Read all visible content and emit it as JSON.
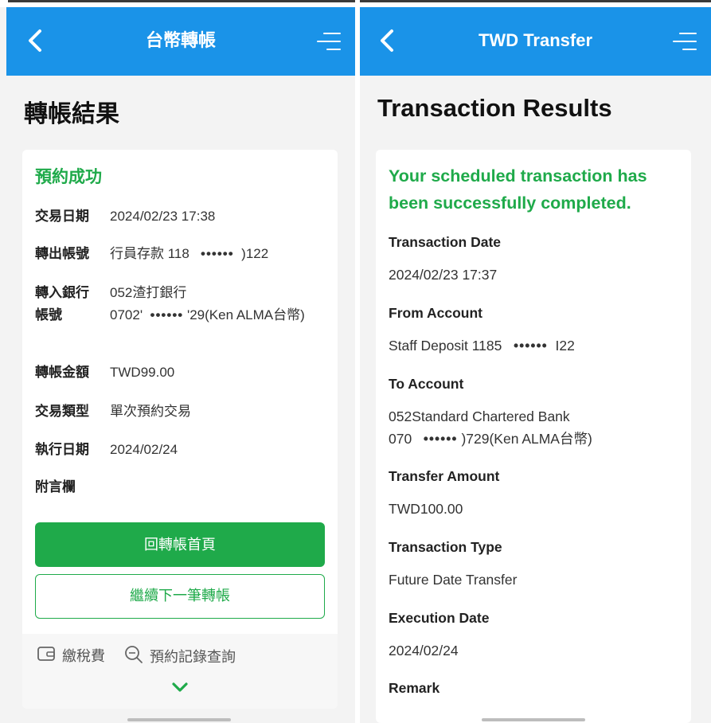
{
  "left": {
    "header_title": "台幣轉帳",
    "page_title": "轉帳結果",
    "status": "預約成功",
    "rows": {
      "date_label": "交易日期",
      "date_value": "2024/02/23 17:38",
      "from_label": "轉出帳號",
      "from_value_prefix": "行員存款 118",
      "from_mask": "••••••",
      "from_value_suffix": ")122",
      "to_label_1": "轉入銀行",
      "to_label_2": "帳號",
      "to_bank": "052渣打銀行",
      "to_account_prefix": "0702'",
      "to_mask": "••••••",
      "to_account_suffix": "'29(Ken ALMA台幣)",
      "amount_label": "轉帳金額",
      "amount_value": "TWD99.00",
      "type_label": "交易類型",
      "type_value": "單次預約交易",
      "exec_label": "執行日期",
      "exec_value": "2024/02/24",
      "remark_label": "附言欄"
    },
    "btn_home": "回轉帳首頁",
    "btn_next": "繼續下一筆轉帳",
    "quick_tax": "繳稅費",
    "quick_query": "預約記錄查詢"
  },
  "right": {
    "header_title": "TWD Transfer",
    "page_title": "Transaction Results",
    "status": "Your scheduled transaction has been successfully completed.",
    "date_label": "Transaction Date",
    "date_value": "2024/02/23 17:37",
    "from_label": "From Account",
    "from_value_prefix": "Staff Deposit 1185",
    "from_mask": "••••••",
    "from_value_suffix": "I22",
    "to_label": "To Account",
    "to_bank": "052Standard Chartered Bank",
    "to_account_prefix": "070",
    "to_mask": "••••••",
    "to_account_suffix": ")729(Ken ALMA台幣)",
    "amount_label": "Transfer Amount",
    "amount_value": "TWD100.00",
    "type_label": "Transaction Type",
    "type_value": "Future Date Transfer",
    "exec_label": "Execution Date",
    "exec_value": "2024/02/24",
    "remark_label": "Remark"
  },
  "colors": {
    "header": "#1a93e8",
    "success": "#1faa4a"
  }
}
